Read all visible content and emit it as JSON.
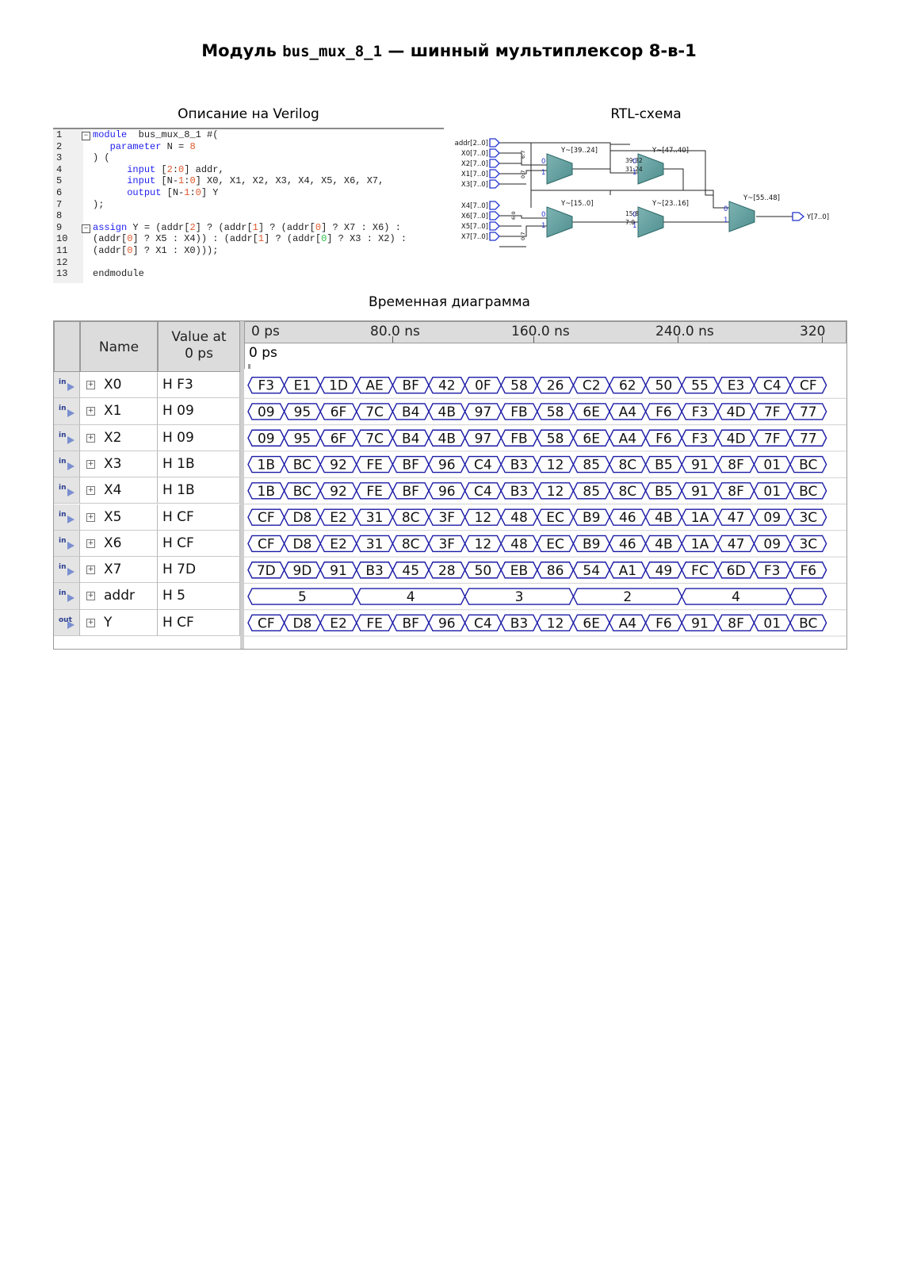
{
  "title": {
    "prefix": "Модуль ",
    "module": "bus_mux_8_1",
    "suffix": " — шинный мультиплексор 8-в-1"
  },
  "captions": {
    "code": "Описание на Verilog",
    "rtl": "RTL-схема",
    "wave": "Временная диаграмма"
  },
  "code_lines": [
    {
      "n": "1",
      "fold": "−",
      "parts": [
        [
          "kw",
          "module"
        ],
        [
          "",
          "  bus_mux_8_1 #("
        ]
      ]
    },
    {
      "n": "2",
      "parts": [
        [
          "",
          "   "
        ],
        [
          "kw",
          "parameter"
        ],
        [
          "",
          " N = "
        ],
        [
          "num",
          "8"
        ]
      ]
    },
    {
      "n": "3",
      "parts": [
        [
          "",
          ") ("
        ]
      ]
    },
    {
      "n": "4",
      "parts": [
        [
          "",
          "      "
        ],
        [
          "kw",
          "input"
        ],
        [
          "",
          " ["
        ],
        [
          "num",
          "2"
        ],
        [
          "",
          ":"
        ],
        [
          "num",
          "0"
        ],
        [
          "",
          "] addr,"
        ]
      ]
    },
    {
      "n": "5",
      "parts": [
        [
          "",
          "      "
        ],
        [
          "kw",
          "input"
        ],
        [
          "",
          " [N-"
        ],
        [
          "num",
          "1"
        ],
        [
          "",
          ":"
        ],
        [
          "num",
          "0"
        ],
        [
          "",
          "] X0, X1, X2, X3, X4, X5, X6, X7,"
        ]
      ]
    },
    {
      "n": "6",
      "parts": [
        [
          "",
          "      "
        ],
        [
          "kw",
          "output"
        ],
        [
          "",
          " [N-"
        ],
        [
          "num",
          "1"
        ],
        [
          "",
          ":"
        ],
        [
          "num",
          "0"
        ],
        [
          "",
          "] Y"
        ]
      ]
    },
    {
      "n": "7",
      "parts": [
        [
          "",
          ");"
        ]
      ]
    },
    {
      "n": "8",
      "parts": [
        [
          "",
          ""
        ]
      ]
    },
    {
      "n": "9",
      "fold": "−",
      "parts": [
        [
          "kw",
          "assign"
        ],
        [
          "",
          " Y = (addr["
        ],
        [
          "num",
          "2"
        ],
        [
          "",
          "] ? (addr["
        ],
        [
          "num",
          "1"
        ],
        [
          "",
          "] ? (addr["
        ],
        [
          "num",
          "0"
        ],
        [
          "",
          "] ? X7 : X6) :"
        ]
      ]
    },
    {
      "n": "10",
      "parts": [
        [
          "",
          "(addr["
        ],
        [
          "num",
          "0"
        ],
        [
          "",
          "] ? X5 : X4)) : (addr["
        ],
        [
          "num",
          "1"
        ],
        [
          "",
          "] ? (addr["
        ],
        [
          "numg",
          "0"
        ],
        [
          "",
          "] ? X3 : X2) :"
        ]
      ]
    },
    {
      "n": "11",
      "parts": [
        [
          "",
          "(addr["
        ],
        [
          "num",
          "0"
        ],
        [
          "",
          "] ? X1 : X0)));"
        ]
      ]
    },
    {
      "n": "12",
      "parts": [
        [
          "",
          ""
        ]
      ]
    },
    {
      "n": "13",
      "parts": [
        [
          "",
          "endmodule"
        ]
      ]
    }
  ],
  "rtl": {
    "inputs_top": [
      "addr[2..0]",
      "X0[7..0]",
      "X2[7..0]",
      "X1[7..0]",
      "X3[7..0]"
    ],
    "inputs_bottom": [
      "X4[7..0]",
      "X6[7..0]",
      "X5[7..0]",
      "X7[7..0]"
    ],
    "output": "Y[7..0]",
    "mux_labels": [
      "Y~[39..24]",
      "Y~[47..40]",
      "Y~[15..0]",
      "Y~[23..16]",
      "Y~[55..48]"
    ],
    "sel_labels": [
      "0",
      "1"
    ],
    "bus_labels": [
      "39:32",
      "31:24",
      "15:8",
      "7:0"
    ],
    "tap_labels": [
      "6:7",
      "0:7",
      "6:0",
      "0:7"
    ]
  },
  "wave": {
    "col_name": "Name",
    "col_value": "Value at\n0 ps",
    "time_ticks": [
      "0 ps",
      "80.0 ns",
      "160.0 ns",
      "240.0 ns",
      "320"
    ],
    "cursor_label": "0 ps",
    "signals": [
      {
        "dir": "in",
        "name": "X0",
        "value": "H F3",
        "vals": [
          "F3",
          "E1",
          "1D",
          "AE",
          "BF",
          "42",
          "0F",
          "58",
          "26",
          "C2",
          "62",
          "50",
          "55",
          "E3",
          "C4",
          "CF"
        ]
      },
      {
        "dir": "in",
        "name": "X1",
        "value": "H 09",
        "vals": [
          "09",
          "95",
          "6F",
          "7C",
          "B4",
          "4B",
          "97",
          "FB",
          "58",
          "6E",
          "A4",
          "F6",
          "F3",
          "4D",
          "7F",
          "77"
        ]
      },
      {
        "dir": "in",
        "name": "X2",
        "value": "H 09",
        "vals": [
          "09",
          "95",
          "6F",
          "7C",
          "B4",
          "4B",
          "97",
          "FB",
          "58",
          "6E",
          "A4",
          "F6",
          "F3",
          "4D",
          "7F",
          "77"
        ]
      },
      {
        "dir": "in",
        "name": "X3",
        "value": "H 1B",
        "vals": [
          "1B",
          "BC",
          "92",
          "FE",
          "BF",
          "96",
          "C4",
          "B3",
          "12",
          "85",
          "8C",
          "B5",
          "91",
          "8F",
          "01",
          "BC"
        ]
      },
      {
        "dir": "in",
        "name": "X4",
        "value": "H 1B",
        "vals": [
          "1B",
          "BC",
          "92",
          "FE",
          "BF",
          "96",
          "C4",
          "B3",
          "12",
          "85",
          "8C",
          "B5",
          "91",
          "8F",
          "01",
          "BC"
        ]
      },
      {
        "dir": "in",
        "name": "X5",
        "value": "H CF",
        "vals": [
          "CF",
          "D8",
          "E2",
          "31",
          "8C",
          "3F",
          "12",
          "48",
          "EC",
          "B9",
          "46",
          "4B",
          "1A",
          "47",
          "09",
          "3C"
        ]
      },
      {
        "dir": "in",
        "name": "X6",
        "value": "H CF",
        "vals": [
          "CF",
          "D8",
          "E2",
          "31",
          "8C",
          "3F",
          "12",
          "48",
          "EC",
          "B9",
          "46",
          "4B",
          "1A",
          "47",
          "09",
          "3C"
        ]
      },
      {
        "dir": "in",
        "name": "X7",
        "value": "H 7D",
        "vals": [
          "7D",
          "9D",
          "91",
          "B3",
          "45",
          "28",
          "50",
          "EB",
          "86",
          "54",
          "A1",
          "49",
          "FC",
          "6D",
          "F3",
          "F6"
        ]
      },
      {
        "dir": "in",
        "name": "addr",
        "value": "H 5",
        "vals": [
          "5",
          "4",
          "3",
          "2",
          "4",
          ""
        ],
        "spans": [
          3,
          3,
          3,
          3,
          3,
          1
        ]
      },
      {
        "dir": "out",
        "name": "Y",
        "value": "H CF",
        "vals": [
          "CF",
          "D8",
          "E2",
          "FE",
          "BF",
          "96",
          "C4",
          "B3",
          "12",
          "6E",
          "A4",
          "F6",
          "91",
          "8F",
          "01",
          "BC"
        ]
      }
    ]
  }
}
